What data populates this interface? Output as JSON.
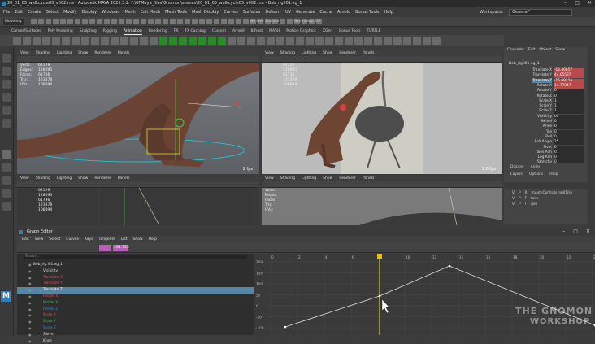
{
  "window": {
    "title": "20_01_05_walkcycle05_v002.ma - Autodesk MAYA 2025.3.2: F:\\0FMaya_files\\Gnomon\\scenes\\20_01_05_walkcycle05_v002.ma - Bob_rig:l01.eg_1"
  },
  "menubar": {
    "items": [
      "File",
      "Edit",
      "Create",
      "Select",
      "Modify",
      "Display",
      "Windows",
      "Mesh",
      "Edit Mesh",
      "Mesh Tools",
      "Mesh Display",
      "Curves",
      "Surfaces",
      "Deform",
      "UV",
      "Generate",
      "Cache",
      "Arnold",
      "Bonus Tools",
      "Help"
    ],
    "workspace_label": "Workspace:",
    "workspace_value": "General*"
  },
  "statusline": {
    "mode": "Modeling",
    "no_live": "No Live Surface",
    "sym": "Symmetry: Off"
  },
  "shelf_tabs": [
    "Curves/Surfaces",
    "Poly Modeling",
    "Sculpting",
    "Rigging",
    "Animation",
    "Rendering",
    "FX",
    "FX Caching",
    "Custom",
    "Arnold",
    "Bifrost",
    "MASH",
    "Motion Graphics",
    "XGen",
    "Bonus Tools",
    "TURTLE"
  ],
  "shelf_active": "Animation",
  "viewport_menu": [
    "View",
    "Shading",
    "Lighting",
    "Show",
    "Renderer",
    "Panels"
  ],
  "vp1": {
    "hud": [
      [
        "Verts:",
        "64129"
      ],
      [
        "Edges:",
        "128095"
      ],
      [
        "Faces:",
        "61736"
      ],
      [
        "Tris:",
        "123378"
      ],
      [
        "UVs:",
        "108894"
      ]
    ],
    "fps": "2 fps"
  },
  "vp2": {
    "hud": [
      [
        "",
        "64129"
      ],
      [
        "",
        "128095"
      ],
      [
        "",
        "61736"
      ],
      [
        "",
        "123378"
      ],
      [
        "",
        "108894"
      ]
    ],
    "fps": "1.6 fps"
  },
  "vp3": {
    "hud": [
      [
        "",
        "64129"
      ],
      [
        "",
        "128095"
      ],
      [
        "",
        "61736"
      ],
      [
        "",
        "123378"
      ],
      [
        "",
        "108894"
      ]
    ]
  },
  "vp4": {
    "hud": [
      [
        "Verts:",
        ""
      ],
      [
        "Edges:",
        ""
      ],
      [
        "Faces:",
        ""
      ],
      [
        "Tris:",
        ""
      ],
      [
        "UVs:",
        ""
      ]
    ]
  },
  "channel_box": {
    "tabs": [
      "Channels",
      "Edit",
      "Object",
      "Show"
    ],
    "object": "Bob_rig:l01.eg_1",
    "attrs": [
      [
        "Translate X",
        "-12.46657",
        false,
        true
      ],
      [
        "Translate Y",
        "44.05587",
        false,
        true
      ],
      [
        "Translate Z",
        "-15.69216",
        true,
        true
      ],
      [
        "Rotate X",
        "14.77847",
        false,
        true
      ],
      [
        "Rotate Y",
        "0",
        false,
        false
      ],
      [
        "Rotate Z",
        "0",
        false,
        false
      ],
      [
        "Scale X",
        "1",
        false,
        false
      ],
      [
        "Scale Y",
        "1",
        false,
        false
      ],
      [
        "Scale Z",
        "1",
        false,
        false
      ],
      [
        "Visibility",
        "on",
        false,
        false
      ],
      [
        "Swivel",
        "0",
        false,
        false
      ],
      [
        "Knee",
        "0",
        false,
        false
      ],
      [
        "Toe",
        "0",
        false,
        false
      ],
      [
        "Roll",
        "0",
        false,
        false
      ],
      [
        "Roll Angle",
        "25",
        false,
        false
      ],
      [
        "Pivot",
        "0",
        false,
        false
      ],
      [
        "Toes Aim",
        "0",
        false,
        false
      ],
      [
        "Leg Aim",
        "0",
        false,
        false
      ],
      [
        "Stretchy",
        "0",
        false,
        false
      ],
      [
        "Anti Pop",
        "0",
        false,
        false
      ]
    ]
  },
  "layer_editor": {
    "tabs": [
      "Display",
      "Anim"
    ],
    "menu": [
      "Layers",
      "Options",
      "Help"
    ],
    "layers": [
      [
        "V",
        "P",
        "R",
        "mouthControls_null1/se"
      ],
      [
        "V",
        "P",
        "T",
        "tans"
      ],
      [
        "V",
        "P",
        "T",
        "geo"
      ]
    ]
  },
  "graph_editor": {
    "title": "Graph Editor",
    "menu": [
      "Edit",
      "View",
      "Select",
      "Curves",
      "Keys",
      "Tangents",
      "List",
      "Show",
      "Help"
    ],
    "search_placeholder": "Search...",
    "stats": "Stats",
    "time_value": "194.753",
    "outliner": [
      [
        "Bob_rig:l01.eg_1",
        false
      ],
      [
        "Visibility",
        false
      ],
      [
        "Translate X",
        false
      ],
      [
        "Translate Y",
        false
      ],
      [
        "Translate Z",
        true
      ],
      [
        "Rotate X",
        false
      ],
      [
        "Rotate Y",
        false
      ],
      [
        "Rotate Z",
        false
      ],
      [
        "Scale X",
        false
      ],
      [
        "Scale Y",
        false
      ],
      [
        "Scale Z",
        false
      ],
      [
        "Swivel",
        false
      ],
      [
        "Knee",
        false
      ]
    ],
    "y_ticks": [
      "200",
      "150",
      "100",
      "50",
      "0",
      "-50",
      "-100"
    ],
    "x_ticks": [
      "0",
      "2",
      "4",
      "6",
      "8",
      "10",
      "12",
      "14",
      "16",
      "18",
      "20",
      "22",
      "24"
    ],
    "current_frame": "6"
  },
  "watermark": {
    "line1": "THE GNOMON",
    "line2": "WORKSHOP"
  }
}
